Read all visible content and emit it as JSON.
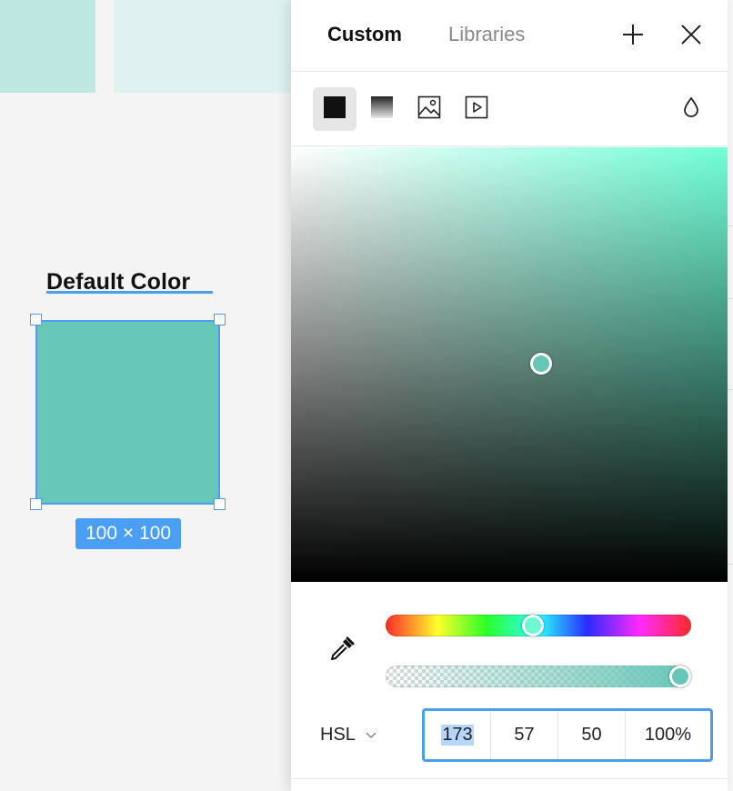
{
  "canvas": {
    "frame_title": "Default Color",
    "rect_fill": "#66c6b7",
    "selection_color": "#4a9ff5",
    "dimensions_badge": "100 × 100"
  },
  "color_panel": {
    "tabs": [
      {
        "label": "Custom",
        "active": true
      },
      {
        "label": "Libraries",
        "active": false
      }
    ],
    "header_icons": [
      "plus-icon",
      "close-icon"
    ],
    "fill_types": [
      {
        "icon": "solid-fill-icon",
        "active": true
      },
      {
        "icon": "gradient-fill-icon",
        "active": false
      },
      {
        "icon": "image-fill-icon",
        "active": false
      },
      {
        "icon": "video-fill-icon",
        "active": false
      }
    ],
    "visibility_icon": "drop-icon",
    "picker_hue": 173,
    "picker_saturation": 57,
    "picker_lightness": 50,
    "opacity_percent": 100,
    "eyedropper_icon": "eyedropper-icon",
    "color_mode": "HSL",
    "values": {
      "h": "173",
      "s": "57",
      "l": "50",
      "a": "100%"
    }
  }
}
